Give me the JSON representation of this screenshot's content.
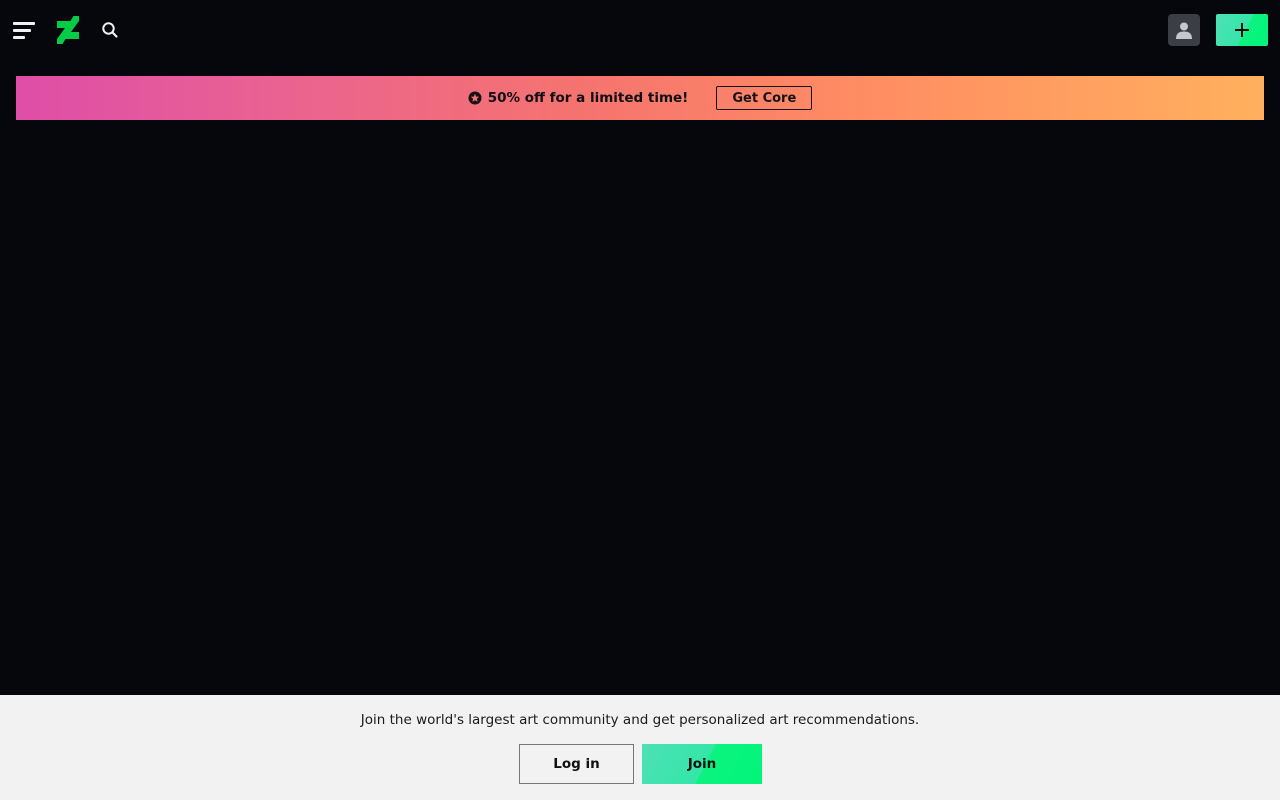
{
  "header": {
    "icons": {
      "menu": "menu-icon",
      "logo": "deviantart-logo-icon",
      "search": "search-icon",
      "avatar": "user-avatar-icon",
      "submit": "plus-icon"
    },
    "colors": {
      "background": "#06070d",
      "brand_green": "#05cc47",
      "accent_gradient_start": "#4ee0b6",
      "accent_gradient_end": "#00f57a"
    }
  },
  "promo": {
    "icon": "star-badge-icon",
    "text": "50% off for a limited time!",
    "cta_label": "Get Core",
    "gradient_start": "#de4ea8",
    "gradient_end": "#ffb05e"
  },
  "join_banner": {
    "text": "Join the world's largest art community and get personalized art recommendations.",
    "login_label": "Log in",
    "join_label": "Join"
  }
}
